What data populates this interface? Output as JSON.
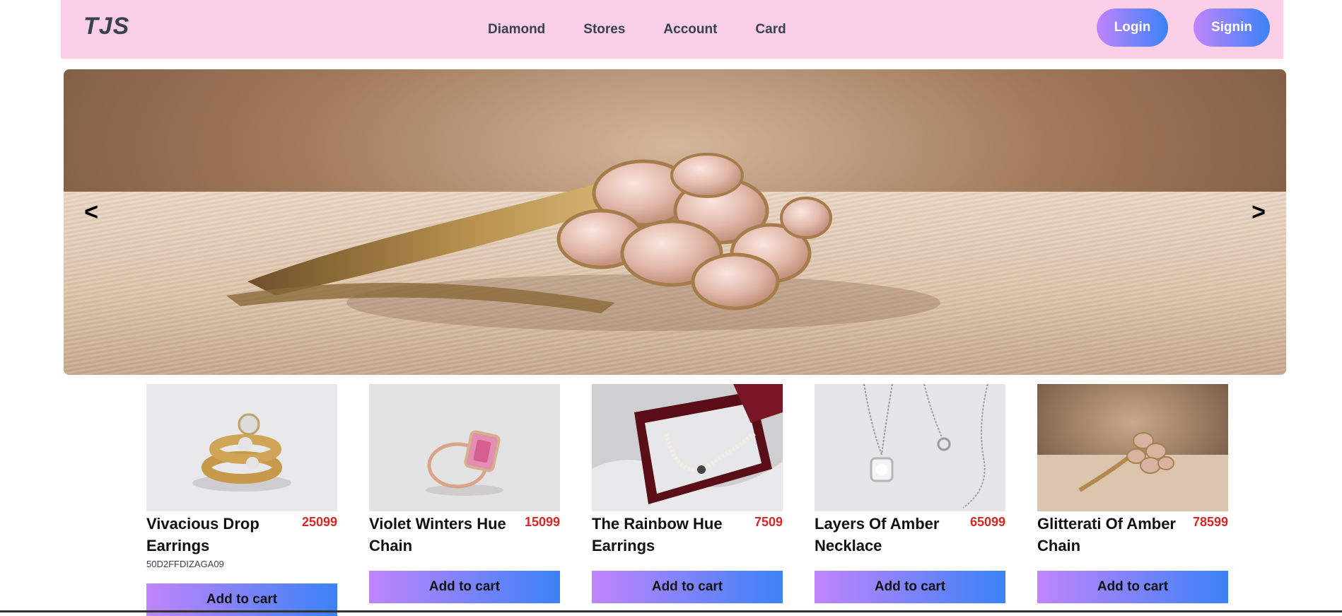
{
  "brand": {
    "logo": "TJS"
  },
  "nav": {
    "links": [
      "Diamond",
      "Stores",
      "Account",
      "Card"
    ],
    "login_label": "Login",
    "signin_label": "Signin"
  },
  "carousel": {
    "prev_label": "<",
    "next_label": ">"
  },
  "products": [
    {
      "name": "Vivacious Drop Earrings",
      "price": "25099",
      "sku": "50D2FFDIZAGA09",
      "cta": "Add to cart"
    },
    {
      "name": "Violet Winters Hue Chain",
      "price": "15099",
      "sku": "",
      "cta": "Add to cart"
    },
    {
      "name": "The Rainbow Hue Earrings",
      "price": "7509",
      "sku": "",
      "cta": "Add to cart"
    },
    {
      "name": "Layers Of Amber Necklace",
      "price": "65099",
      "sku": "",
      "cta": "Add to cart"
    },
    {
      "name": "Glitterati Of Amber Chain",
      "price": "78599",
      "sku": "",
      "cta": "Add to cart"
    }
  ],
  "colors": {
    "navbar_bg": "#fbcfe8",
    "gradient_start": "#c084fc",
    "gradient_end": "#3b82f6",
    "price": "#dc2626"
  }
}
